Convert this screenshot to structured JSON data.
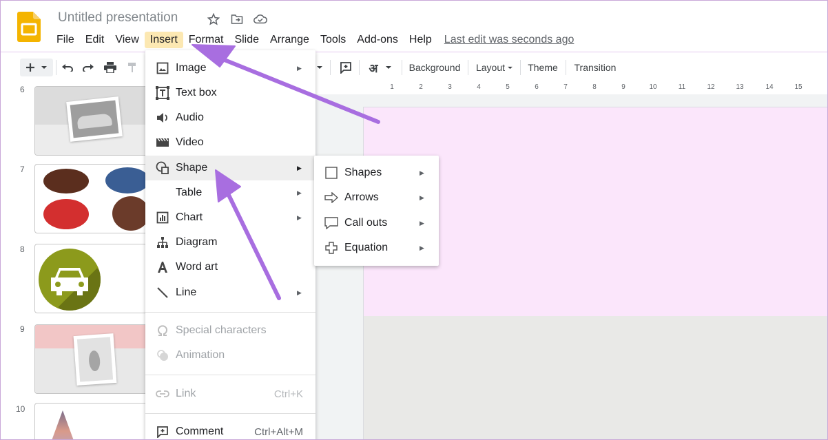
{
  "app": {
    "title": "Untitled presentation",
    "last_edit": "Last edit was seconds ago",
    "accent": "#f4b400"
  },
  "menubar": [
    "File",
    "Edit",
    "View",
    "Insert",
    "Format",
    "Slide",
    "Arrange",
    "Tools",
    "Add-ons",
    "Help"
  ],
  "toolbar": {
    "background": "Background",
    "layout": "Layout",
    "theme": "Theme",
    "transition": "Transition",
    "input_tools": "अ"
  },
  "ruler": [
    "1",
    "2",
    "3",
    "4",
    "5",
    "6",
    "7",
    "8",
    "9",
    "10",
    "11",
    "12",
    "13",
    "14",
    "15"
  ],
  "filmstrip": {
    "slide_numbers": [
      "6",
      "7",
      "8",
      "9",
      "10"
    ]
  },
  "insert_menu": {
    "items": [
      {
        "label": "Image",
        "icon": "image-icon",
        "submenu": true
      },
      {
        "label": "Text box",
        "icon": "text-box-icon"
      },
      {
        "label": "Audio",
        "icon": "audio-icon"
      },
      {
        "label": "Video",
        "icon": "video-icon"
      },
      {
        "label": "Shape",
        "icon": "shape-icon",
        "submenu": true,
        "highlighted": true
      },
      {
        "label": "Table",
        "icon": "",
        "submenu": true
      },
      {
        "label": "Chart",
        "icon": "chart-icon",
        "submenu": true
      },
      {
        "label": "Diagram",
        "icon": "diagram-icon"
      },
      {
        "label": "Word art",
        "icon": "word-art-icon"
      },
      {
        "label": "Line",
        "icon": "line-icon",
        "submenu": true
      }
    ],
    "disabled": [
      {
        "label": "Special characters",
        "icon": "omega-icon"
      },
      {
        "label": "Animation",
        "icon": "animation-icon"
      }
    ],
    "link": {
      "label": "Link",
      "shortcut": "Ctrl+K"
    },
    "comment": {
      "label": "Comment",
      "shortcut": "Ctrl+Alt+M"
    }
  },
  "shape_submenu": [
    {
      "label": "Shapes",
      "icon": "square-shape-icon"
    },
    {
      "label": "Arrows",
      "icon": "arrow-shape-icon"
    },
    {
      "label": "Call outs",
      "icon": "callout-shape-icon"
    },
    {
      "label": "Equation",
      "icon": "plus-shape-icon"
    }
  ],
  "colors": {
    "slide_pink": "#fbe6fb",
    "annotation_arrow": "#a86ee0",
    "menu_highlight": "#fce8b2"
  }
}
